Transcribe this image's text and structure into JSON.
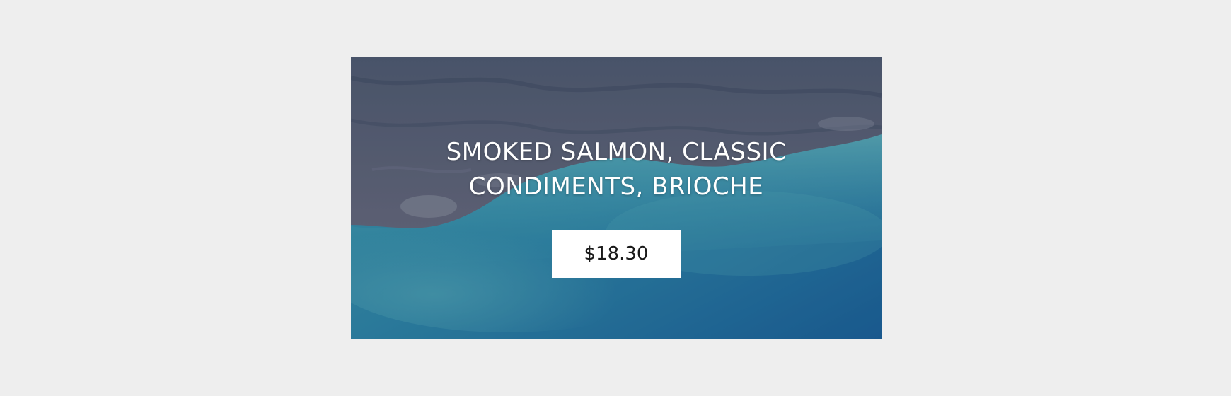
{
  "product": {
    "title": "SMOKED SALMON, CLASSIC CONDIMENTS, BRIOCHE",
    "price": "$18.30"
  },
  "colors": {
    "page_background": "#eeeeee",
    "land": "#5a6478",
    "shallow_water": "#3aa3b5",
    "deep_water": "#1a6b9c",
    "button_background": "#ffffff",
    "title_text": "#ffffff",
    "price_text": "#1a1a1a"
  }
}
